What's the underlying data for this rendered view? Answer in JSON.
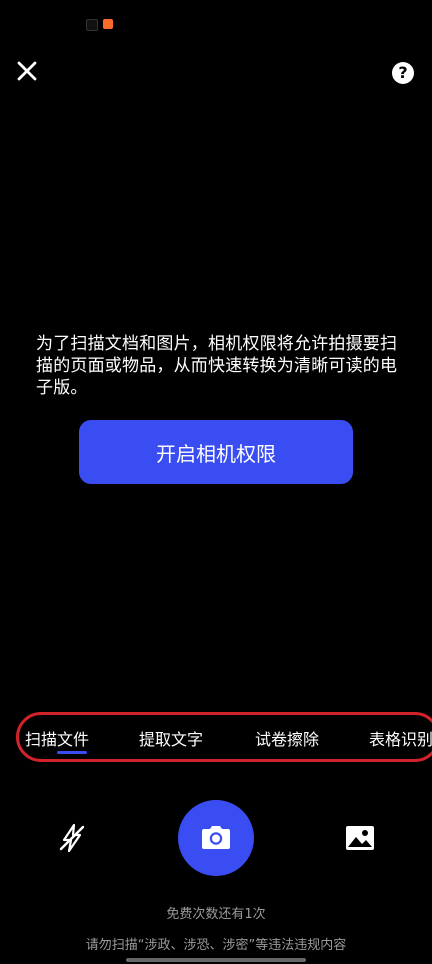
{
  "header": {
    "close_icon": "close-icon",
    "help_icon": "help-icon",
    "help_symbol": "?"
  },
  "permission": {
    "message": "为了扫描文档和图片，相机权限将允许拍摄要扫描的页面或物品，从而快速转换为清晰可读的电子版。",
    "button_label": "开启相机权限"
  },
  "tabs": [
    {
      "label": "扫描文件",
      "selected": true
    },
    {
      "label": "提取文字",
      "selected": false
    },
    {
      "label": "试卷擦除",
      "selected": false
    },
    {
      "label": "表格识别",
      "selected": false
    }
  ],
  "controls": {
    "flash_icon": "flash-off-icon",
    "shutter_icon": "camera-icon",
    "gallery_icon": "image-gallery-icon"
  },
  "footer": {
    "free_count": "免费次数还有1次",
    "warning": "请勿扫描“涉政、涉恐、涉密”等违法违规内容"
  },
  "colors": {
    "accent": "#3a4df2",
    "highlight_border": "#d2232a",
    "background": "#000000",
    "muted_text": "#9a9a9a"
  }
}
